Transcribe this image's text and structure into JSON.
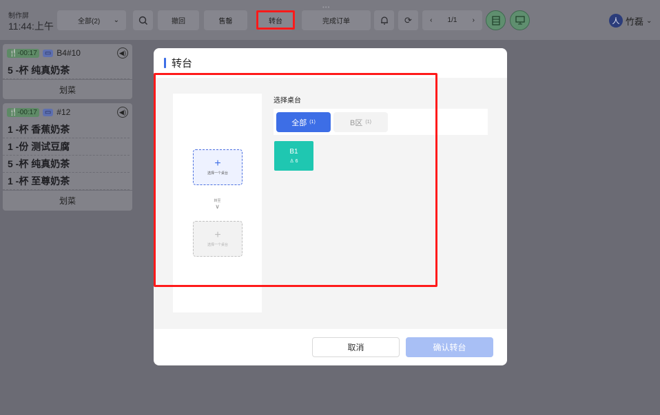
{
  "header": {
    "screen_title": "制作屏",
    "time": "11:44:上午",
    "filter_label": "全部(2)",
    "search_icon": "search-icon",
    "buttons": {
      "undo": "撤回",
      "sold_out": "售罄",
      "transfer": "转台",
      "complete": "完成订单"
    },
    "pager": {
      "page": "1/1"
    },
    "user": {
      "avatar_glyph": "人",
      "name": "竹磊"
    }
  },
  "orders": [
    {
      "timer": "-00:17",
      "table": "B4#10",
      "items": [
        "5 -杯  纯真奶茶"
      ],
      "action": "划菜"
    },
    {
      "timer": "-00:17",
      "table": "#12",
      "items": [
        "1 -杯  香蕉奶茶",
        "1 -份  测试豆腐",
        "5 -杯  纯真奶茶",
        "1 -杯  至尊奶茶"
      ],
      "action": "划菜"
    }
  ],
  "modal": {
    "title": "转台",
    "from_slot": {
      "plus": "+",
      "label": "选择一个桌台"
    },
    "transfer_label": "转至",
    "to_slot": {
      "plus": "+",
      "label": "选择一个桌台"
    },
    "section_label": "选择桌台",
    "tabs": [
      {
        "label": "全部",
        "count": "(1)"
      },
      {
        "label": "B区",
        "count": "(1)"
      }
    ],
    "tables": [
      {
        "name": "B1",
        "capacity": "6"
      }
    ],
    "cancel_label": "取消",
    "confirm_label": "确认转台"
  },
  "colors": {
    "accent": "#3d6ee6",
    "table_tile": "#1fc7b1",
    "highlight": "#ff1a1a",
    "confirm_disabled": "#a8bff5"
  }
}
